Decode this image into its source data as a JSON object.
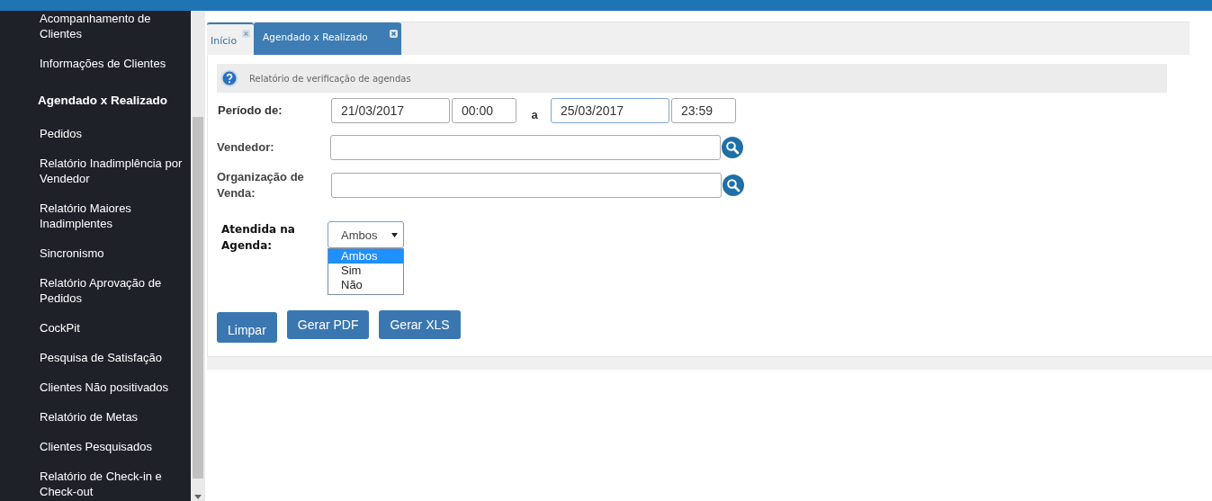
{
  "sidebar": {
    "items": [
      {
        "label": "Acompanhamento de Clientes",
        "selected": false
      },
      {
        "label": "Informações de Clientes",
        "selected": false
      },
      {
        "label": "Agendado x Realizado",
        "selected": true
      },
      {
        "label": "Pedidos",
        "selected": false
      },
      {
        "label": "Relatório Inadimplência por Vendedor",
        "selected": false
      },
      {
        "label": "Relatório Maiores Inadimplentes",
        "selected": false
      },
      {
        "label": "Sincronismo",
        "selected": false
      },
      {
        "label": "Relatório Aprovação de Pedidos",
        "selected": false
      },
      {
        "label": "CockPit",
        "selected": false
      },
      {
        "label": "Pesquisa de Satisfação",
        "selected": false
      },
      {
        "label": "Clientes Não positivados",
        "selected": false
      },
      {
        "label": "Relatório de Metas",
        "selected": false
      },
      {
        "label": "Clientes Pesquisados",
        "selected": false
      },
      {
        "label": "Relatório de Check-in e Check-out",
        "selected": false
      }
    ]
  },
  "tabs": [
    {
      "label": "Início",
      "selected": false
    },
    {
      "label": "Agendado x Realizado",
      "selected": true
    }
  ],
  "panel": {
    "title": "Relatório de verificação de agendas"
  },
  "form": {
    "period_label": "Período de:",
    "date_from": "21/03/2017",
    "time_from": "00:00",
    "separator": "a",
    "date_to": "25/03/2017",
    "time_to": "23:59",
    "seller_label": "Vendedor:",
    "org_label": "Organização de Venda:",
    "attended_label": "Atendida na Agenda:",
    "attended_value": "Ambos",
    "attended_expanded": true,
    "attended_options": [
      {
        "label": "Ambos",
        "selected": true
      },
      {
        "label": "Sim",
        "selected": false
      },
      {
        "label": "Não",
        "selected": false
      }
    ]
  },
  "buttons": [
    "Limpar",
    "Gerar PDF",
    "Gerar XLS"
  ]
}
